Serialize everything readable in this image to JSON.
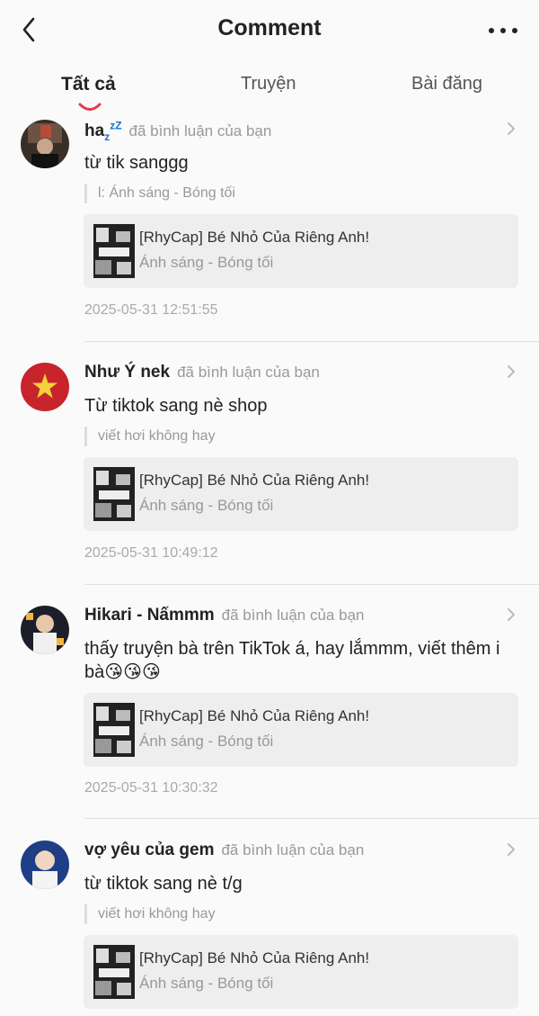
{
  "header": {
    "title": "Comment"
  },
  "tabs": [
    {
      "label": "Tất cả"
    },
    {
      "label": "Truyện"
    },
    {
      "label": "Bài đăng"
    }
  ],
  "comments": [
    {
      "name_prefix": "ha",
      "name_sub": "z",
      "name_sup": "zZ",
      "action": "đã bình luận của bạn",
      "text": "từ tik sanggg",
      "quote": "l: Ánh sáng - Bóng tối",
      "book_title": "[RhyCap] Bé Nhỏ Của Riêng Anh!",
      "book_sub": "Ánh sáng - Bóng tối",
      "time": "2025-05-31 12:51:55"
    },
    {
      "name": "Như Ý nek",
      "action": "đã bình luận của bạn",
      "text": "Từ tiktok sang nè shop",
      "quote": "viết hơi không hay",
      "book_title": "[RhyCap] Bé Nhỏ Của Riêng Anh!",
      "book_sub": "Ánh sáng - Bóng tối",
      "time": "2025-05-31 10:49:12"
    },
    {
      "name": "Hikari - Nấmmm",
      "action": "đã bình luận của bạn",
      "text_line1": "thấy truyện bà trên TikTok á, hay lắmmm, viết thêm i",
      "text_line2": "bà",
      "book_title": "[RhyCap] Bé Nhỏ Của Riêng Anh!",
      "book_sub": "Ánh sáng - Bóng tối",
      "time": "2025-05-31 10:30:32"
    },
    {
      "name": "vợ yêu của gem",
      "action": "đã bình luận của bạn",
      "text": "từ tiktok sang nè t/g",
      "quote": "viết hơi không hay",
      "book_title": "[RhyCap] Bé Nhỏ Của Riêng Anh!",
      "book_sub": "Ánh sáng - Bóng tối"
    }
  ]
}
